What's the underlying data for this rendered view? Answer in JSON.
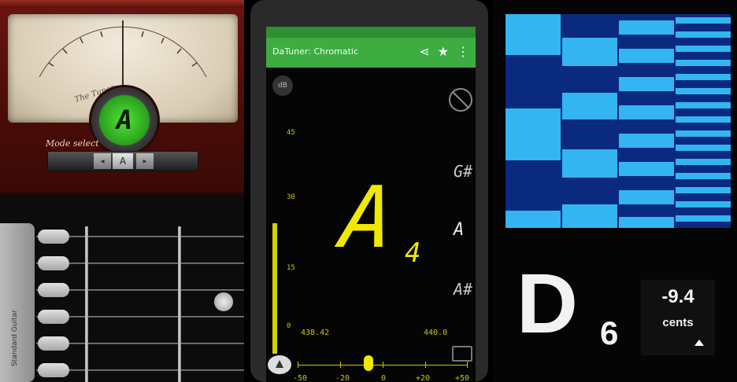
{
  "left": {
    "needle_note": "A",
    "script_text": "Mode select",
    "slider_value": "A",
    "tuning_label": "Standard Guitar"
  },
  "mid": {
    "app_title": "DaTuner: Chromatic",
    "db_badge": "dB",
    "scale": [
      "45",
      "30",
      "15",
      "0"
    ],
    "note": "A",
    "octave": "4",
    "side_notes": [
      "G#",
      "A",
      "A#"
    ],
    "freq_left": "438.42",
    "freq_right": "440.0",
    "axis_labels": [
      "-50",
      "-20",
      "0",
      "+20",
      "+50"
    ]
  },
  "right": {
    "note": "D",
    "octave": "6",
    "cents_value": "-9.4",
    "cents_label": "cents"
  }
}
